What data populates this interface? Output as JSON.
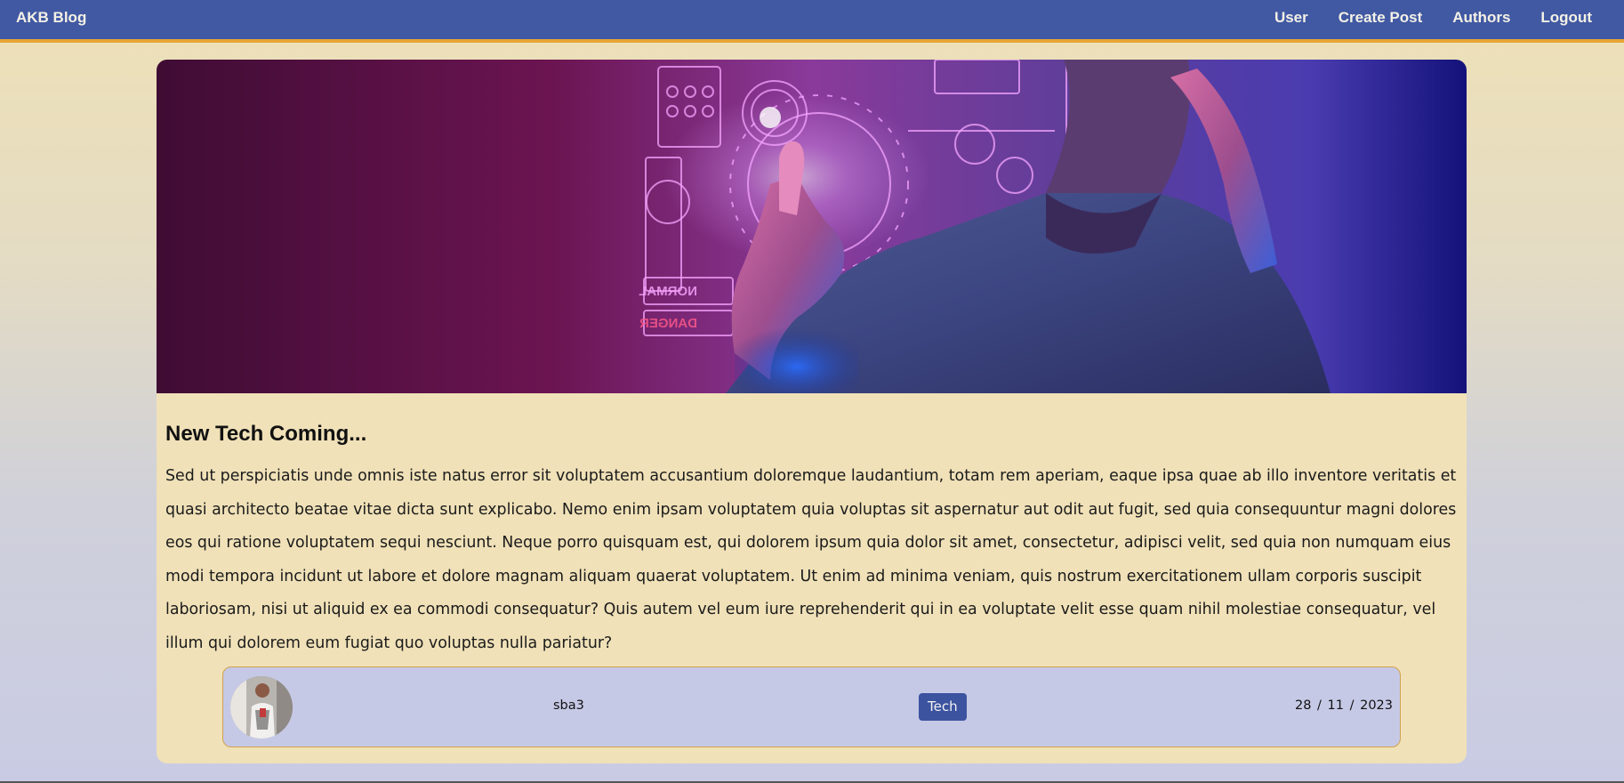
{
  "navbar": {
    "brand": "AKB Blog",
    "links": [
      "User",
      "Create Post",
      "Authors",
      "Logout"
    ],
    "background_color": "#4159a3",
    "accent_color": "#e8a534"
  },
  "post": {
    "title": "New Tech Coming...",
    "body": "Sed ut perspiciatis unde omnis iste natus error sit voluptatem accusantium doloremque laudantium, totam rem aperiam, eaque ipsa quae ab illo inventore veritatis et quasi architecto beatae vitae dicta sunt explicabo. Nemo enim ipsam voluptatem quia voluptas sit aspernatur aut odit aut fugit, sed quia consequuntur magni dolores eos qui ratione voluptatem sequi nesciunt. Neque porro quisquam est, qui dolorem ipsum quia dolor sit amet, consectetur, adipisci velit, sed quia non numquam eius modi tempora incidunt ut labore et dolore magnam aliquam quaerat voluptatem. Ut enim ad minima veniam, quis nostrum exercitationem ullam corporis suscipit laboriosam, nisi ut aliquid ex ea commodi consequatur? Quis autem vel eum iure reprehenderit qui in ea voluptate velit esse quam nihil molestiae consequatur, vel illum qui dolorem eum fugiat quo voluptas nulla pariatur?",
    "author": "sba3",
    "category": "Tech",
    "date": "28 / 11 / 2023",
    "hero_image_overlay_text": [
      "NORMAL",
      "DANGER"
    ],
    "category_color": "#3c53a0"
  }
}
